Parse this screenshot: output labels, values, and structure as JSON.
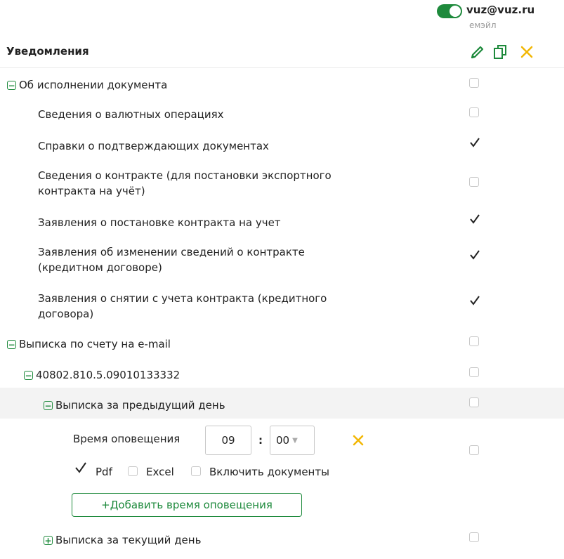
{
  "account": {
    "email": "vuz@vuz.ru",
    "email_type": "емэйл",
    "toggle_on": true
  },
  "header": {
    "title": "Уведомления"
  },
  "actions": {
    "edit_icon": "pencil-icon",
    "copy_icon": "copy-icon",
    "delete_icon": "close-icon",
    "accent_green": "#1e8a3c",
    "accent_orange": "#f2b705"
  },
  "rows": [
    {
      "label": "Об исполнении документа",
      "expander": "−",
      "checked": false
    },
    {
      "label": "Сведения о валютных операциях",
      "checked": false
    },
    {
      "label": "Справки о подтверждающих документах",
      "checked": true
    },
    {
      "label_line1": "Сведения о контракте (для постановки экспортного",
      "label_line2": "контракта на учёт)",
      "checked": false
    },
    {
      "label": "Заявления о постановке контракта на учет",
      "checked": true
    },
    {
      "label_line1": "Заявления об изменении сведений о контракте",
      "label_line2": "(кредитном договоре)",
      "checked": true
    },
    {
      "label_line1": "Заявления о снятии с учета контракта (кредитного",
      "label_line2": "договора)",
      "checked": true
    },
    {
      "label": "Выписка по счету на e-mail",
      "expander": "−",
      "checked": false
    },
    {
      "label": "40802.810.5.09010133332",
      "expander": "−",
      "checked": false
    },
    {
      "label": "Выписка за предыдущий день",
      "expander": "−",
      "checked": false
    },
    {
      "label": "Выписка за текущий день",
      "expander": "+",
      "checked": false
    }
  ],
  "schedule": {
    "time_label": "Время оповещения",
    "hours": "09",
    "separator": ":",
    "minutes": "00",
    "formats": [
      {
        "label": "Pdf",
        "checked": true
      },
      {
        "label": "Excel",
        "checked": false
      },
      {
        "label": "Включить документы",
        "checked": false
      }
    ],
    "add_button": "+Добавить время оповещения"
  }
}
